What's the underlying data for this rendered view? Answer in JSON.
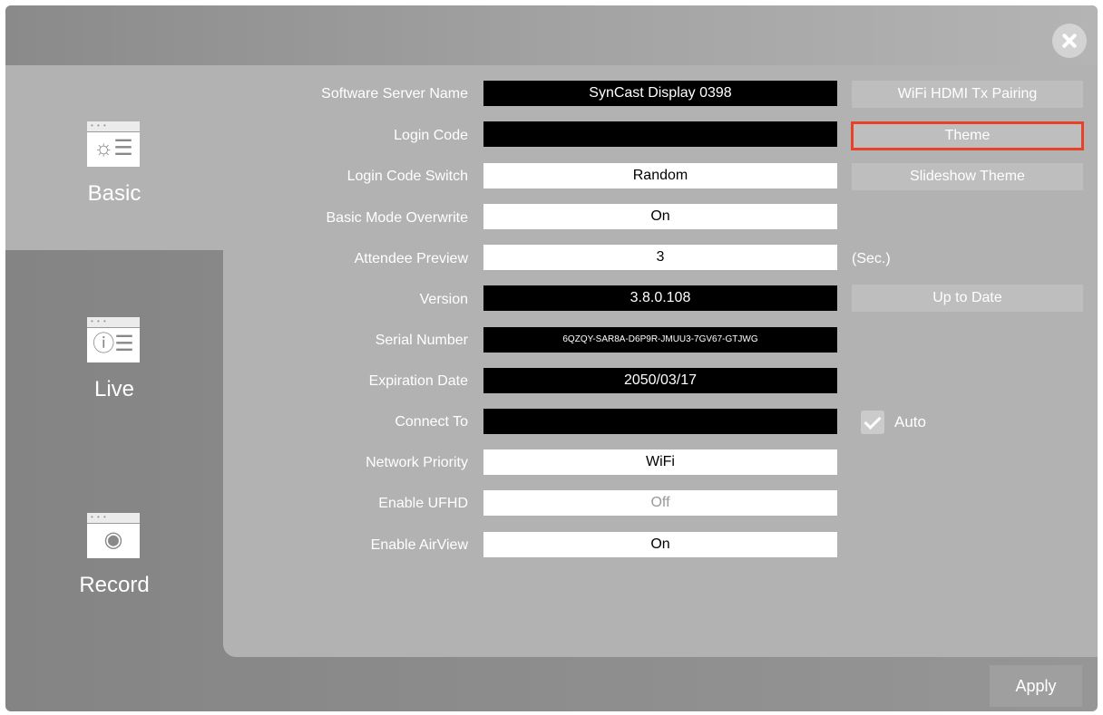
{
  "close": {
    "icon": "close-icon"
  },
  "sidebar": {
    "items": [
      {
        "label": "Basic",
        "icon": "settings-window-icon",
        "glyph": "☼☰"
      },
      {
        "label": "Live",
        "icon": "info-window-icon",
        "glyph": "ⓘ☰"
      },
      {
        "label": "Record",
        "icon": "record-window-icon",
        "glyph": "◉"
      }
    ]
  },
  "settings": {
    "software_server_name": {
      "label": "Software Server Name",
      "value": "SynCast Display 0398"
    },
    "login_code": {
      "label": "Login Code",
      "value": ""
    },
    "login_code_switch": {
      "label": "Login Code Switch",
      "value": "Random"
    },
    "basic_mode_overwrite": {
      "label": "Basic Mode Overwrite",
      "value": "On"
    },
    "attendee_preview": {
      "label": "Attendee Preview",
      "value": "3",
      "unit": "(Sec.)"
    },
    "version": {
      "label": "Version",
      "value": "3.8.0.108"
    },
    "serial_number": {
      "label": "Serial Number",
      "value": "6QZQY-SAR8A-D6P9R-JMUU3-7GV67-GTJWG"
    },
    "expiration_date": {
      "label": "Expiration Date",
      "value": "2050/03/17"
    },
    "connect_to": {
      "label": "Connect To",
      "value": "",
      "auto_label": "Auto",
      "auto_checked": true
    },
    "network_priority": {
      "label": "Network Priority",
      "value": "WiFi"
    },
    "enable_ufhd": {
      "label": "Enable UFHD",
      "value": "Off"
    },
    "enable_airview": {
      "label": "Enable AirView",
      "value": "On"
    }
  },
  "side_buttons": {
    "wifi_pairing": "WiFi HDMI Tx Pairing",
    "theme": "Theme",
    "slideshow_theme": "Slideshow Theme",
    "up_to_date": "Up to Date"
  },
  "footer": {
    "apply": "Apply"
  },
  "colors": {
    "highlight": "#e8412a"
  }
}
